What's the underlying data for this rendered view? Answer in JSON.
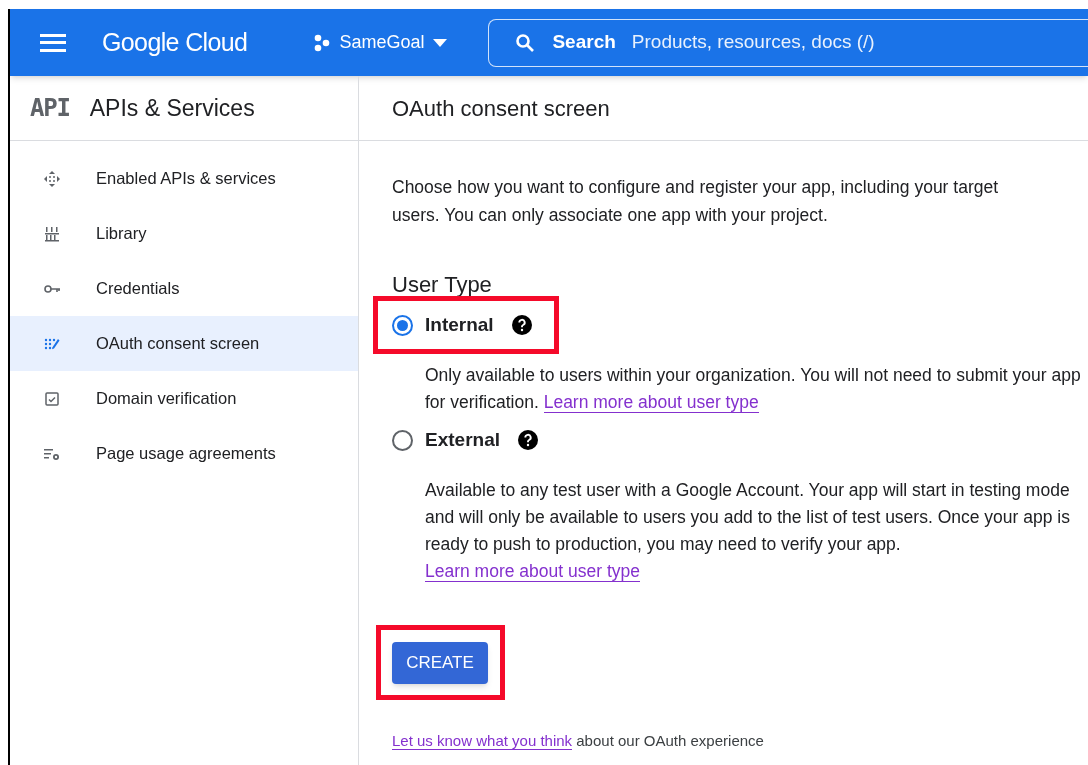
{
  "header": {
    "logo": "Google Cloud",
    "project": "SameGoal",
    "search": {
      "label": "Search",
      "placeholder": "Products, resources, docs (/)"
    }
  },
  "sidebar": {
    "badge": "API",
    "title": "APIs & Services",
    "items": [
      {
        "label": "Enabled APIs & services",
        "kind": "hub",
        "selected": false
      },
      {
        "label": "Library",
        "kind": "library",
        "selected": false
      },
      {
        "label": "Credentials",
        "kind": "key",
        "selected": false
      },
      {
        "label": "OAuth consent screen",
        "kind": "consent",
        "selected": true
      },
      {
        "label": "Domain verification",
        "kind": "check",
        "selected": false
      },
      {
        "label": "Page usage agreements",
        "kind": "settings",
        "selected": false
      }
    ]
  },
  "page": {
    "title": "OAuth consent screen",
    "intro": "Choose how you want to configure and register your app, including your target users. You can only associate one app with your project.",
    "user_type": {
      "heading": "User Type",
      "options": [
        {
          "label": "Internal",
          "selected": true,
          "highlighted": true,
          "description": "Only available to users within your organization. You will not need to submit your app for verification.",
          "link": "Learn more about user type"
        },
        {
          "label": "External",
          "selected": false,
          "highlighted": false,
          "description": "Available to any test user with a Google Account. Your app will start in testing mode and will only be available to users you add to the list of test users. Once your app is ready to push to production, you may need to verify your app.",
          "link": "Learn more about user type"
        }
      ]
    },
    "create_button": {
      "label": "CREATE",
      "highlighted": true
    },
    "feedback": {
      "link": "Let us know what you think",
      "text": "about our OAuth experience"
    }
  }
}
